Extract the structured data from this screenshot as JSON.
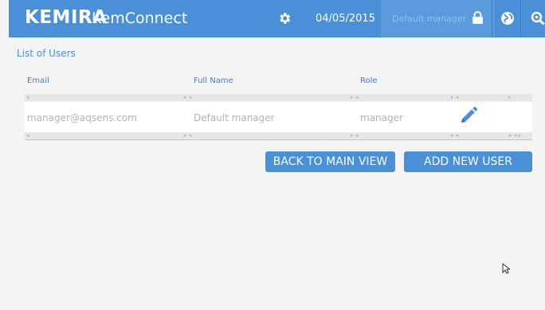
{
  "header": {
    "brand_name": "Kemira",
    "brand_display": "KEMIRA",
    "app_name": "KemConnect",
    "date": "04/05/2015",
    "user": "Default manager"
  },
  "page": {
    "title": "List of Users"
  },
  "table": {
    "columns": [
      "Email",
      "Full Name",
      "Role"
    ],
    "rows": [
      {
        "email": "manager@aqsens.com",
        "full_name": "Default manager",
        "role": "manager"
      }
    ]
  },
  "buttons": {
    "back": "BACK TO MAIN VIEW",
    "add": "ADD NEW USER"
  },
  "colors": {
    "accent": "#4a90d8",
    "background": "#f4f4f4"
  }
}
